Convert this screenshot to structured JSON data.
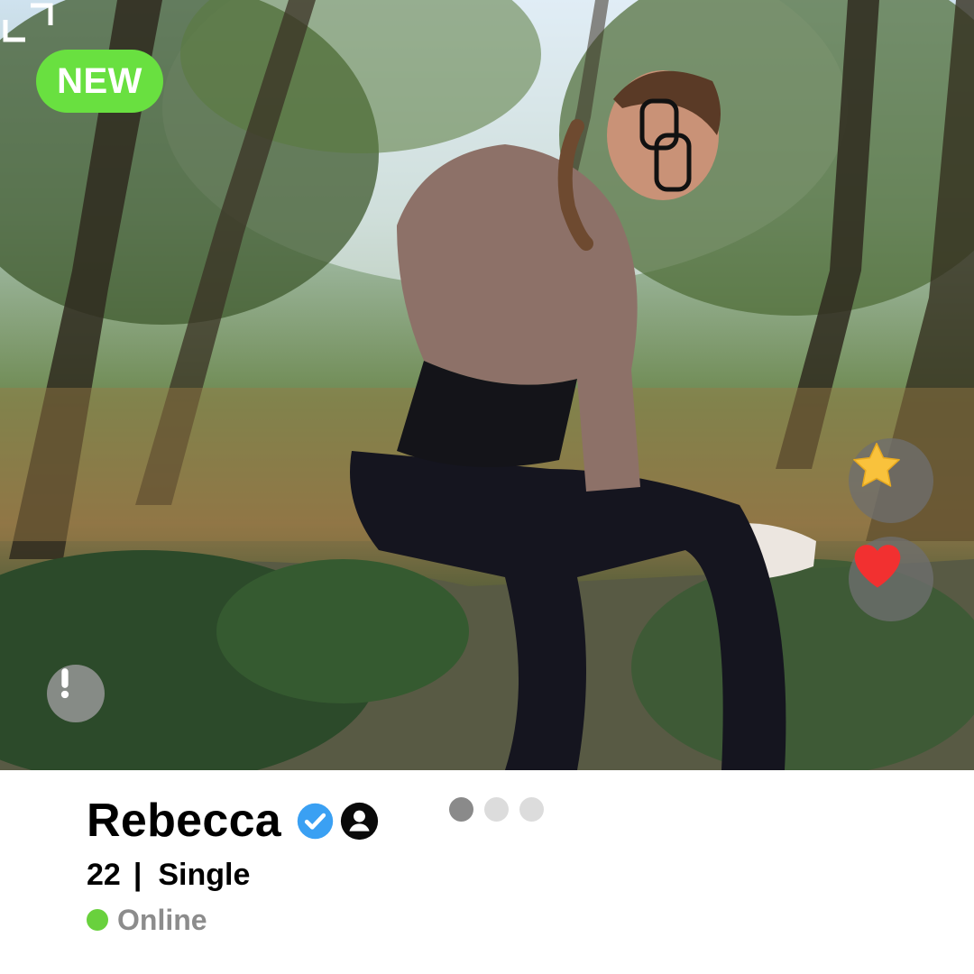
{
  "profile": {
    "badge": "NEW",
    "name": "Rebecca",
    "age": "22",
    "separator": "|",
    "relationship": "Single",
    "status": "Online"
  },
  "photo_pager": {
    "count": 3,
    "active_index": 0
  },
  "icons": {
    "favorite": "star-icon",
    "like": "heart-icon",
    "report": "exclamation-icon",
    "expand": "expand-icon",
    "verified": "verified-check-icon",
    "profile": "user-profile-icon"
  },
  "colors": {
    "badge_green": "#69e040",
    "star": "#f9c23c",
    "heart": "#f23030",
    "verified_blue": "#3aa0f3",
    "online_green": "#69d13d",
    "status_gray": "#8c8c8c"
  }
}
